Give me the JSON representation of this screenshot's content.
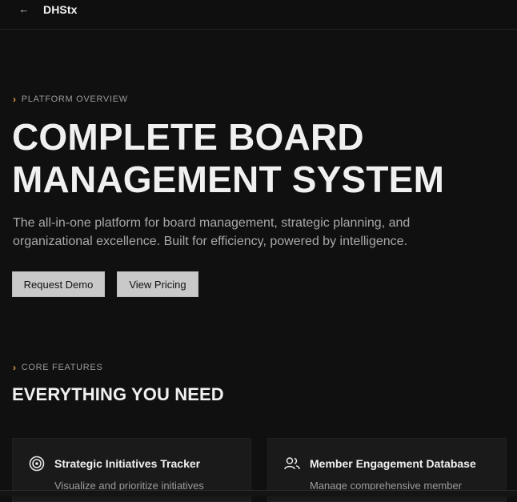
{
  "header": {
    "back_icon": "arrow-left-icon",
    "brand": "DHStx"
  },
  "hero": {
    "eyebrow": "PLATFORM OVERVIEW",
    "title_line1": "COMPLETE BOARD",
    "title_line2": "MANAGEMENT SYSTEM",
    "subtitle_line1": "The all-in-one platform for board management, strategic planning, and",
    "subtitle_line2": "organizational excellence. Built for efficiency, powered by intelligence.",
    "primary_button": "Request Demo",
    "secondary_button": "View Pricing"
  },
  "features": {
    "eyebrow": "CORE FEATURES",
    "title": "EVERYTHING YOU NEED",
    "cards": [
      {
        "icon": "target-icon",
        "title": "Strategic Initiatives Tracker",
        "description": "Visualize and prioritize initiatives"
      },
      {
        "icon": "users-icon",
        "title": "Member Engagement Database",
        "description": "Manage comprehensive member"
      }
    ]
  },
  "colors": {
    "background": "#101010",
    "accent": "#e2a03f",
    "button_bg": "#c9c9c9",
    "card_bg": "#1a1a1a"
  }
}
